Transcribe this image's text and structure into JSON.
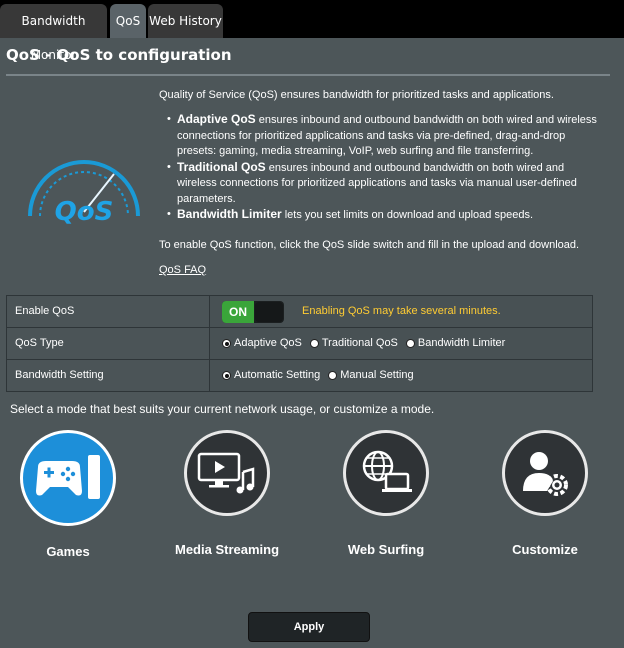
{
  "tabs": [
    {
      "label": "Bandwidth Monitor"
    },
    {
      "label": "QoS"
    },
    {
      "label": "Web History"
    }
  ],
  "page": {
    "title": "QoS - QoS to configuration",
    "logo_text": "QoS",
    "intro": "Quality of Service (QoS) ensures bandwidth for prioritized tasks and applications.",
    "bullets": [
      {
        "bold": "Adaptive QoS",
        "text": " ensures inbound and outbound bandwidth on both wired and wireless connections for prioritized applications and tasks via pre-defined, drag-and-drop presets: gaming, media streaming, VoIP, web surfing and file transferring."
      },
      {
        "bold": "Traditional QoS",
        "text": " ensures inbound and outbound bandwidth on both wired and wireless connections for prioritized applications and tasks via manual user-defined parameters."
      },
      {
        "bold": "Bandwidth Limiter",
        "text": " lets you set limits on download and upload speeds."
      }
    ],
    "enable_note": "To enable QoS function, click the QoS slide switch and fill in the upload and download.",
    "faq_link": "QoS FAQ"
  },
  "settings": {
    "enable": {
      "label": "Enable QoS",
      "toggle_text": "ON",
      "warning": "Enabling QoS may take several minutes."
    },
    "type": {
      "label": "QoS Type",
      "options": [
        "Adaptive QoS",
        "Traditional QoS",
        "Bandwidth Limiter"
      ],
      "selected": "Adaptive QoS"
    },
    "bandwidth": {
      "label": "Bandwidth Setting",
      "options": [
        "Automatic Setting",
        "Manual Setting"
      ],
      "selected": "Automatic Setting"
    }
  },
  "modes": {
    "prompt": "Select a mode that best suits your current network usage, or customize a mode.",
    "items": [
      {
        "label": "Games",
        "icon": "gamepad-icon",
        "selected": true
      },
      {
        "label": "Media Streaming",
        "icon": "media-streaming-icon",
        "selected": false
      },
      {
        "label": "Web Surfing",
        "icon": "web-surfing-icon",
        "selected": false
      },
      {
        "label": "Customize",
        "icon": "customize-icon",
        "selected": false
      }
    ]
  },
  "apply_label": "Apply",
  "colors": {
    "accent_blue": "#1d8fd9",
    "toggle_green": "#3aa53a",
    "warning_yellow": "#ffcc33",
    "background": "#4d5659"
  }
}
